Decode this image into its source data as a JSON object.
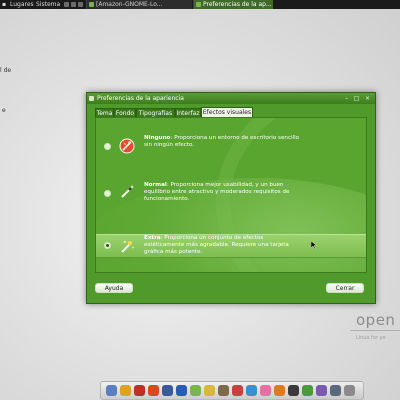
{
  "top_panel": {
    "places_label": "Lugares",
    "system_label": "Sistema",
    "tasks": [
      {
        "label": "[Amazon-GNOME-Lo..."
      },
      {
        "label": "Preferencias de la ap..."
      }
    ]
  },
  "desktop": {
    "labels": [
      "l de",
      "e"
    ]
  },
  "window": {
    "title": "Preferencias de la apariencia",
    "minimize": "–",
    "maximize": "□",
    "close": "×",
    "tabs": [
      {
        "label": "Tema"
      },
      {
        "label": "Fondo"
      },
      {
        "label": "Tipografías"
      },
      {
        "label": "Interfaz"
      },
      {
        "label": "Efectos visuales"
      }
    ],
    "active_tab": "Efectos visuales",
    "options": [
      {
        "name": "Ninguno",
        "description": ": Proporciona un entorno de escritorio sencillo sin ningún efecto.",
        "selected": false,
        "icon": "no-effects-icon"
      },
      {
        "name": "Normal",
        "description": ": Proporciona mejor usabilidad, y un buen equilibrio entre atractivo y moderados requisitos de funcionamiento.",
        "selected": false,
        "icon": "wand-icon"
      },
      {
        "name": "Extra",
        "description": ": Proporciona un conjunto de efectos estéticamente más agradable. Requiere una tarjeta gráfica más potente.",
        "selected": true,
        "icon": "magic-sparkle-icon"
      }
    ],
    "help_button": "Ayuda",
    "close_button": "Cerrar"
  },
  "branding": {
    "name": "open",
    "sub": "Linux for yo"
  },
  "dock": {
    "icons": [
      {
        "name": "finder-icon",
        "color": "#5a7fc0"
      },
      {
        "name": "clock-icon",
        "color": "#e0a020"
      },
      {
        "name": "yahoo-icon",
        "color": "#c0302a"
      },
      {
        "name": "ubuntu-circle-icon",
        "color": "#d84a1b"
      },
      {
        "name": "facebook-icon",
        "color": "#3b5998"
      },
      {
        "name": "ebay-icon",
        "color": "#2a5bb8"
      },
      {
        "name": "chat-icon",
        "color": "#7ab648"
      },
      {
        "name": "note-icon",
        "color": "#d8b83a"
      },
      {
        "name": "photo-icon",
        "color": "#7c6a4a"
      },
      {
        "name": "calendar-icon",
        "color": "#c84040"
      },
      {
        "name": "music-icon",
        "color": "#3a8fd0"
      },
      {
        "name": "flower-icon",
        "color": "#e86fa0"
      },
      {
        "name": "firefox-icon",
        "color": "#e07a20"
      },
      {
        "name": "terminal-icon",
        "color": "#3a3a3a"
      },
      {
        "name": "player-icon",
        "color": "#4a9a3a"
      },
      {
        "name": "pidgin-icon",
        "color": "#7a5ab0"
      },
      {
        "name": "display-icon",
        "color": "#5a6a7a"
      },
      {
        "name": "trash-icon",
        "color": "#8a8a8a"
      }
    ]
  }
}
